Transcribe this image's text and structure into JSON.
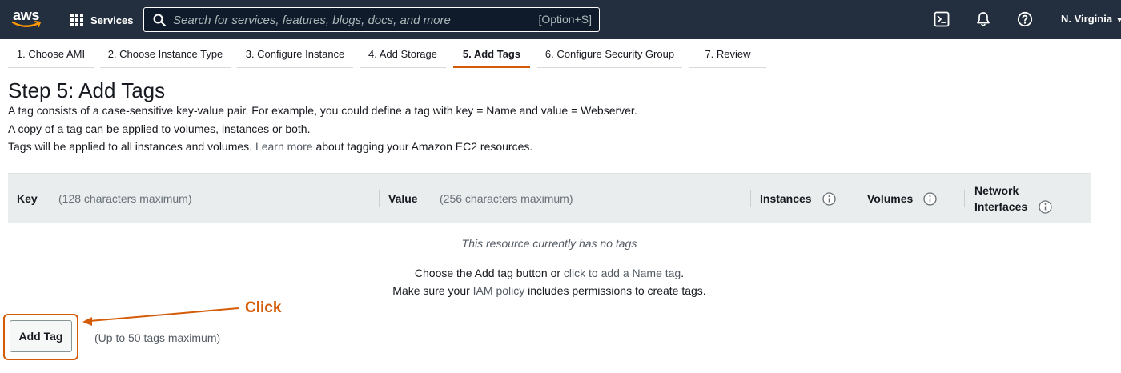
{
  "colors": {
    "nav_bg": "#232f3e",
    "active_tab_underline": "#d45b07",
    "annotation": "#d45b07",
    "table_header_bg": "#eaeded"
  },
  "topnav": {
    "logo_text": "aws",
    "services_label": "Services",
    "search_placeholder": "Search for services, features, blogs, docs, and more",
    "search_shortcut": "[Option+S]",
    "icons": [
      "cloudshell-icon",
      "bell-icon",
      "help-icon"
    ],
    "region": "N. Virginia"
  },
  "tabs": [
    {
      "label": "1. Choose AMI",
      "active": false
    },
    {
      "label": "2. Choose Instance Type",
      "active": false
    },
    {
      "label": "3. Configure Instance",
      "active": false
    },
    {
      "label": "4. Add Storage",
      "active": false
    },
    {
      "label": "5. Add Tags",
      "active": true
    },
    {
      "label": "6. Configure Security Group",
      "active": false
    },
    {
      "label": "7. Review",
      "active": false
    }
  ],
  "page": {
    "title": "Step 5: Add Tags",
    "desc_line1": "A tag consists of a case-sensitive key-value pair. For example, you could define a tag with key = Name and value = Webserver.",
    "desc_line2": "A copy of a tag can be applied to volumes, instances or both.",
    "desc_line3_prefix": "Tags will be applied to all instances and volumes.",
    "desc_line3_link": "Learn more",
    "desc_line3_suffix": "about tagging your Amazon EC2 resources."
  },
  "table": {
    "key_label": "Key",
    "key_hint": "(128 characters maximum)",
    "value_label": "Value",
    "value_hint": "(256 characters maximum)",
    "instances_label": "Instances",
    "volumes_label": "Volumes",
    "network_label_1": "Network",
    "network_label_2": "Interfaces",
    "empty_title": "This resource currently has no tags",
    "empty_line1_prefix": "Choose the Add tag button or",
    "empty_line1_link": "click to add a Name tag",
    "empty_line1_suffix": ".",
    "empty_line2_prefix": "Make sure your",
    "empty_line2_link": "IAM policy",
    "empty_line2_suffix": "includes permissions to create tags."
  },
  "actions": {
    "add_tag_label": "Add Tag",
    "max_note": "(Up to 50 tags maximum)"
  },
  "annotation": {
    "label": "Click"
  }
}
